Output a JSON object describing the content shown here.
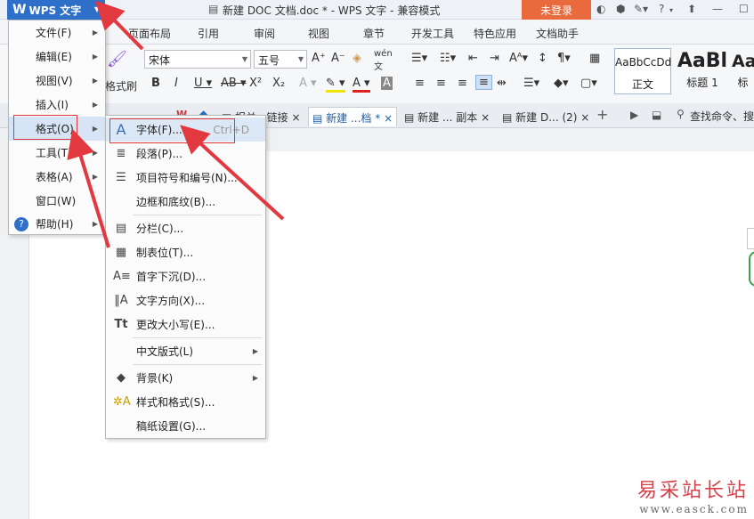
{
  "titlebar": {
    "app_name": "WPS 文字",
    "doc_title": "新建 DOC 文档.doc * - WPS 文字 - 兼容模式",
    "login_label": "未登录",
    "help_label": "?"
  },
  "ribbon_tabs": [
    "页面布局",
    "引用",
    "审阅",
    "视图",
    "章节",
    "开发工具",
    "特色应用",
    "文档助手"
  ],
  "ribbon": {
    "format_painter_label": "格式刷",
    "font_name": "宋体",
    "font_size": "五号",
    "styles": [
      {
        "preview": "AaBbCcDd",
        "name": "正文"
      },
      {
        "preview": "AaBl",
        "name": "标题 1"
      },
      {
        "preview": "Aa",
        "name": "标"
      }
    ]
  },
  "doc_tabs": [
    {
      "label": "报关...链接",
      "active": false
    },
    {
      "label": "新建 ...档 *",
      "active": true
    },
    {
      "label": "新建 ... 副本",
      "active": false
    },
    {
      "label": "新建 D... (2)",
      "active": false
    }
  ],
  "search_placeholder": "查找命令、搜",
  "main_menu": {
    "items": [
      {
        "label": "文件(F)",
        "has_submenu": true
      },
      {
        "label": "编辑(E)",
        "has_submenu": true
      },
      {
        "label": "视图(V)",
        "has_submenu": true
      },
      {
        "label": "插入(I)",
        "has_submenu": true
      },
      {
        "label": "格式(O)",
        "has_submenu": true,
        "highlighted": true
      },
      {
        "label": "工具(T)",
        "has_submenu": true
      },
      {
        "label": "表格(A)",
        "has_submenu": true
      },
      {
        "label": "窗口(W)",
        "has_submenu": false
      },
      {
        "label": "帮助(H)",
        "has_submenu": true
      }
    ]
  },
  "format_menu": {
    "items": [
      {
        "label": "字体(F)...",
        "shortcut": "Ctrl+D",
        "icon": "font-icon",
        "highlighted": true
      },
      {
        "label": "段落(P)...",
        "icon": "paragraph-icon"
      },
      {
        "label": "项目符号和编号(N)...",
        "icon": "bullets-icon"
      },
      {
        "label": "边框和底纹(B)...",
        "icon": ""
      },
      {
        "label": "分栏(C)...",
        "icon": "columns-icon"
      },
      {
        "label": "制表位(T)...",
        "icon": "tabstop-icon"
      },
      {
        "label": "首字下沉(D)...",
        "icon": "dropcap-icon"
      },
      {
        "label": "文字方向(X)...",
        "icon": "text-direction-icon"
      },
      {
        "label": "更改大小写(E)...",
        "icon": "change-case-icon"
      },
      {
        "label": "中文版式(L)",
        "icon": "",
        "has_submenu": true
      },
      {
        "label": "背景(K)",
        "icon": "background-icon",
        "has_submenu": true
      },
      {
        "label": "样式和格式(S)...",
        "icon": "styles-icon"
      },
      {
        "label": "稿纸设置(G)...",
        "icon": ""
      }
    ]
  },
  "watermark": {
    "line1": "易采站长站",
    "line2": "www.easck.com"
  },
  "colors": {
    "accent": "#2e6fc9",
    "login": "#e86a3d",
    "highlight_box": "#e0353a",
    "arrow": "#e2383f"
  }
}
